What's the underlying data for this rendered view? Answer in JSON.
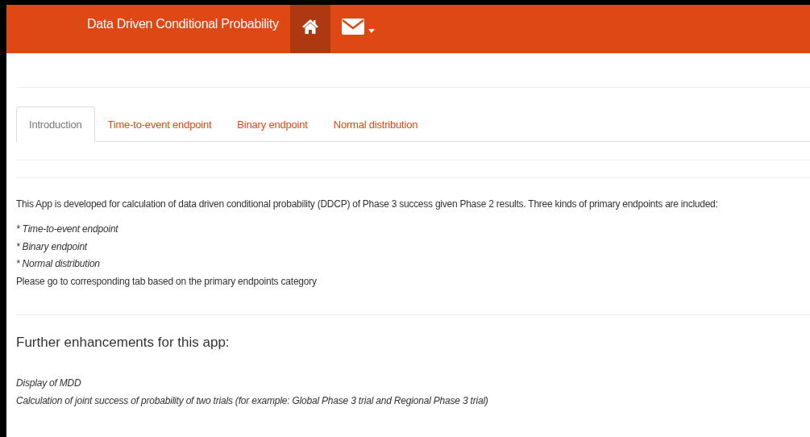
{
  "navbar": {
    "brand": "Data Driven Conditional Probability",
    "items": [
      {
        "kind": "home",
        "selected": true,
        "dropdown": false
      },
      {
        "kind": "mail",
        "selected": false,
        "dropdown": true
      }
    ]
  },
  "tabs": [
    {
      "label": "Introduction",
      "selected": true
    },
    {
      "label": "Time-to-event endpoint",
      "selected": false
    },
    {
      "label": "Binary endpoint",
      "selected": false
    },
    {
      "label": "Normal distribution",
      "selected": false
    }
  ],
  "intro": {
    "text": "This App is developed for calculation of data driven conditional probability (DDCP) of Phase 3 success given Phase 2 results. Three kinds of primary endpoints are included:",
    "endpoints": [
      "* Time-to-event endpoint",
      "* Binary endpoint",
      "* Normal distribution"
    ],
    "note": "Please go to corresponding tab based on the primary endpoints category"
  },
  "enhancements": {
    "heading": "Further enhancements for this app:",
    "items": [
      "Display of MDD",
      "Calculation of joint success of probability of two trials (for example: Global Phase 3 trial and Regional Phase 3 trial)"
    ]
  }
}
